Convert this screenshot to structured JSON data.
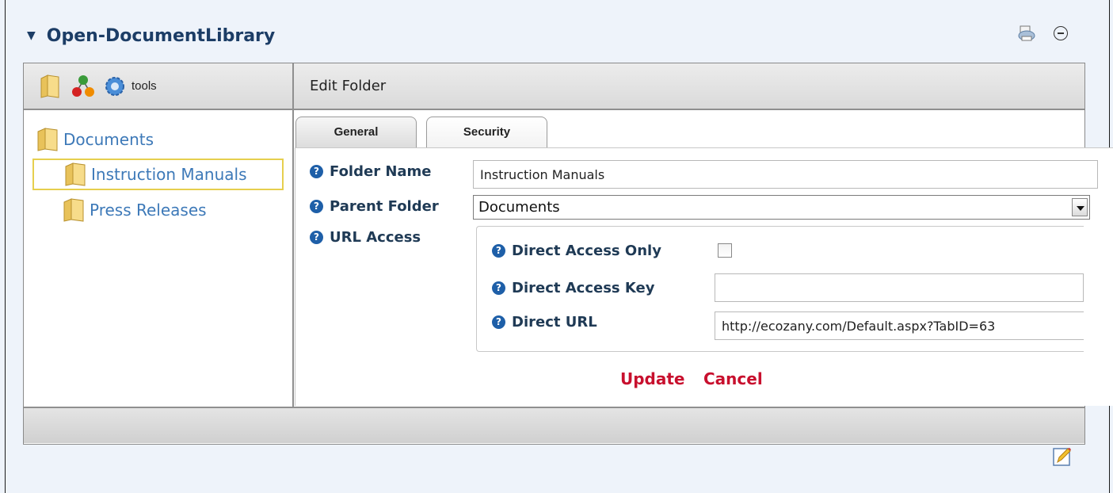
{
  "module": {
    "title": "Open-DocumentLibrary"
  },
  "toolbar": {
    "tools_label": "tools"
  },
  "edit_panel": {
    "title": "Edit Folder"
  },
  "tree": {
    "root": "Documents",
    "children": [
      {
        "label": "Instruction Manuals",
        "selected": true
      },
      {
        "label": "Press Releases",
        "selected": false
      }
    ]
  },
  "tabs": [
    {
      "label": "General",
      "active": true
    },
    {
      "label": "Security",
      "active": false
    }
  ],
  "form": {
    "folder_name_label": "Folder Name",
    "folder_name_value": "Instruction Manuals",
    "parent_folder_label": "Parent Folder",
    "parent_folder_value": "Documents",
    "url_access_label": "URL Access",
    "direct_access_only_label": "Direct Access Only",
    "direct_access_only_checked": false,
    "direct_access_key_label": "Direct Access Key",
    "direct_access_key_value": "",
    "direct_url_label": "Direct URL",
    "direct_url_value": "http://ecozany.com/Default.aspx?TabID=63"
  },
  "actions": {
    "update": "Update",
    "cancel": "Cancel"
  },
  "colors": {
    "link_blue": "#3d79b8",
    "title_navy": "#1c3d66",
    "action_red": "#c8102e",
    "help_icon_blue": "#1e5fa8",
    "selection_border": "#e6cf4e"
  }
}
